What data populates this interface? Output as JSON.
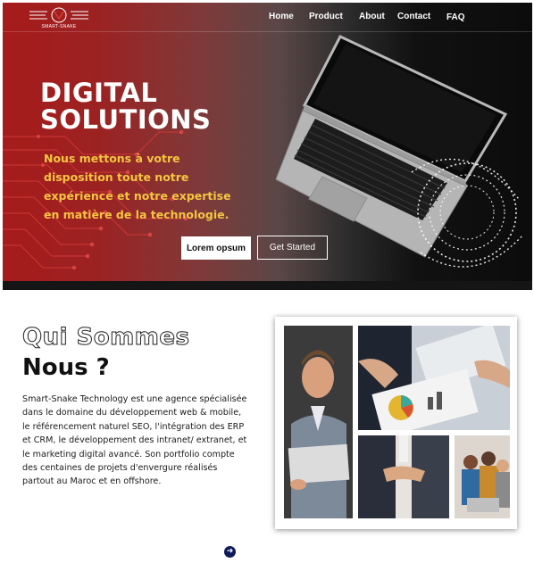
{
  "brand": {
    "logo_text": "SMART-SNAKE"
  },
  "nav": {
    "items": [
      {
        "label": "Home"
      },
      {
        "label": "Product"
      },
      {
        "label": "About"
      },
      {
        "label": "Contact"
      },
      {
        "label": "FAQ"
      }
    ]
  },
  "hero": {
    "title_line1": "DIGITAL",
    "title_line2": "SOLUTIONS",
    "subtitle": "Nous mettons à votre disposition toute notre expérience et notre expertise en matière de la technologie.",
    "primary_button": "Lorem opsum",
    "secondary_button": "Get Started"
  },
  "about": {
    "title_outline": "Qui Sommes",
    "title_solid": "Nous ?",
    "text": "Smart-Snake Technology est une agence spécialisée dans le domaine du développement web & mobile, le référencement naturel SEO, l'intégration des ERP et CRM, le développement des intranet/ extranet, et le marketing digital avancé. Son portfolio compte des centaines de projets d'envergure réalisés partout au Maroc et en offshore."
  },
  "colors": {
    "hero_red": "#a61b1b",
    "hero_dark": "#0c0c0c",
    "subtitle_yellow": "#f4c542",
    "scroll_button": "#0d1a5c"
  },
  "icons": {
    "scroll": "arrow-right-icon"
  }
}
